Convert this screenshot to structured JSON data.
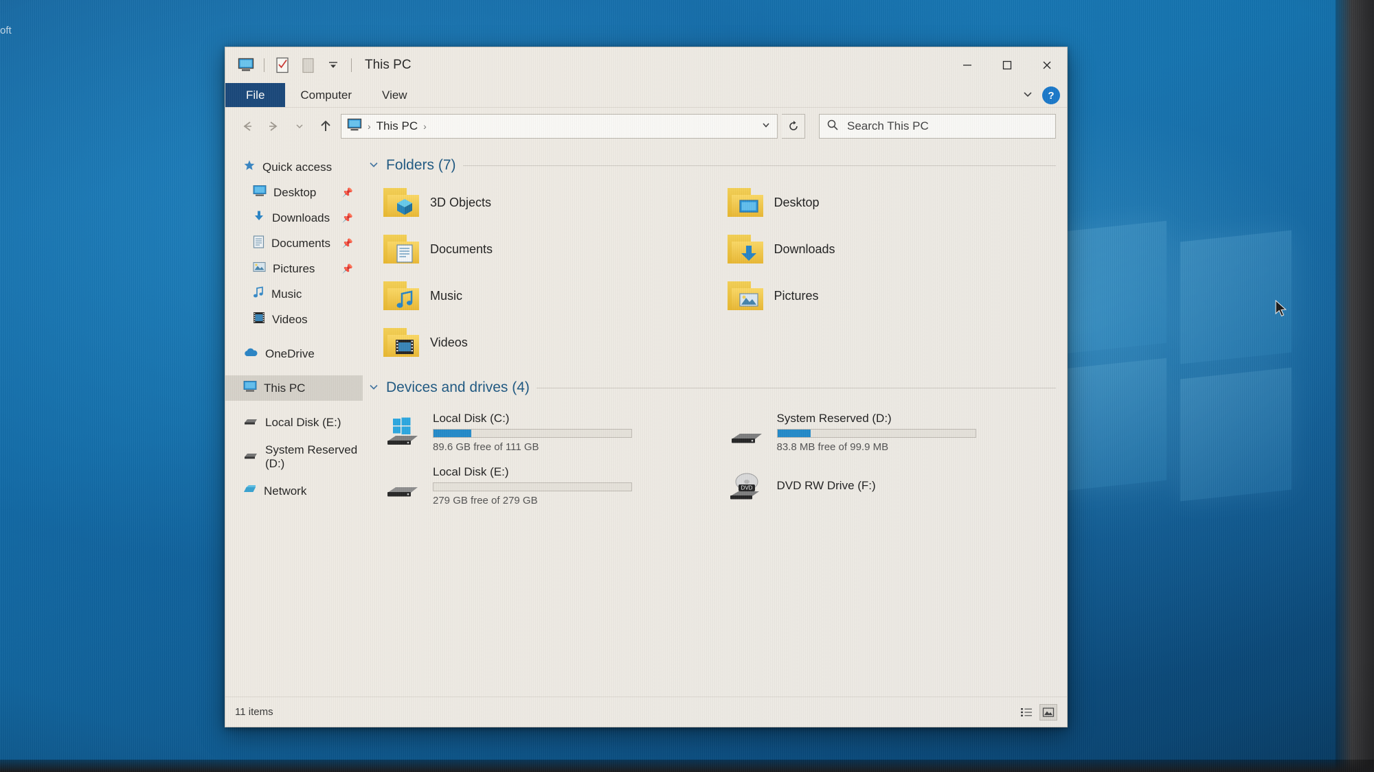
{
  "window": {
    "title": "This PC",
    "quick_access_icons": [
      "this-pc-icon",
      "properties-icon",
      "new-folder-icon",
      "customize-dropdown-icon"
    ],
    "controls": {
      "minimize": "–",
      "maximize": "☐",
      "close": "✕"
    }
  },
  "ribbon": {
    "tabs": [
      {
        "label": "File",
        "active": true
      },
      {
        "label": "Computer",
        "active": false
      },
      {
        "label": "View",
        "active": false
      }
    ],
    "collapse_icon": "chevron-down-icon",
    "help_label": "?"
  },
  "address": {
    "back_icon": "arrow-left-icon",
    "forward_icon": "arrow-right-icon",
    "recent_icon": "chevron-down-icon",
    "up_icon": "arrow-up-icon",
    "location_icon": "this-pc-icon",
    "crumbs": [
      "This PC"
    ],
    "separator": "›",
    "dropdown_icon": "chevron-down-icon",
    "refresh_icon": "refresh-icon"
  },
  "search": {
    "icon": "search-icon",
    "placeholder": "Search This PC",
    "value": ""
  },
  "sidebar": {
    "items": [
      {
        "label": "Quick access",
        "icon": "star-pin-icon",
        "indent": false,
        "pinned": false,
        "selected": false
      },
      {
        "label": "Desktop",
        "icon": "desktop-icon",
        "indent": true,
        "pinned": true,
        "selected": false
      },
      {
        "label": "Downloads",
        "icon": "download-icon",
        "indent": true,
        "pinned": true,
        "selected": false
      },
      {
        "label": "Documents",
        "icon": "document-icon",
        "indent": true,
        "pinned": true,
        "selected": false
      },
      {
        "label": "Pictures",
        "icon": "pictures-icon",
        "indent": true,
        "pinned": true,
        "selected": false
      },
      {
        "label": "Music",
        "icon": "music-icon",
        "indent": true,
        "pinned": false,
        "selected": false
      },
      {
        "label": "Videos",
        "icon": "videos-icon",
        "indent": true,
        "pinned": false,
        "selected": false
      },
      {
        "label": "OneDrive",
        "icon": "cloud-icon",
        "indent": false,
        "pinned": false,
        "selected": false,
        "gap_before": true
      },
      {
        "label": "This PC",
        "icon": "this-pc-icon",
        "indent": false,
        "pinned": false,
        "selected": true,
        "gap_before": true
      },
      {
        "label": "Local Disk (E:)",
        "icon": "drive-icon",
        "indent": false,
        "pinned": false,
        "selected": false,
        "gap_before": true
      },
      {
        "label": "System Reserved (D:)",
        "icon": "drive-icon",
        "indent": false,
        "pinned": false,
        "selected": false,
        "gap_before": true
      },
      {
        "label": "Network",
        "icon": "network-icon",
        "indent": false,
        "pinned": false,
        "selected": false,
        "gap_before": true
      }
    ]
  },
  "main": {
    "folders_group": {
      "title": "Folders (7)",
      "chevron": "chevron-down-icon",
      "items": [
        {
          "label": "3D Objects",
          "icon": "folder-3d-objects-icon"
        },
        {
          "label": "Desktop",
          "icon": "folder-desktop-icon"
        },
        {
          "label": "Documents",
          "icon": "folder-documents-icon"
        },
        {
          "label": "Downloads",
          "icon": "folder-downloads-icon"
        },
        {
          "label": "Music",
          "icon": "folder-music-icon"
        },
        {
          "label": "Pictures",
          "icon": "folder-pictures-icon"
        },
        {
          "label": "Videos",
          "icon": "folder-videos-icon"
        }
      ]
    },
    "drives_group": {
      "title": "Devices and drives (4)",
      "chevron": "chevron-down-icon",
      "items": [
        {
          "name": "Local Disk (C:)",
          "free": "89.6 GB free of 111 GB",
          "used_percent": 19,
          "icon": "windows-drive-icon",
          "has_bar": true
        },
        {
          "name": "System Reserved (D:)",
          "free": "83.8 MB free of 99.9 MB",
          "used_percent": 17,
          "icon": "drive-icon",
          "has_bar": true
        },
        {
          "name": "Local Disk (E:)",
          "free": "279 GB free of 279 GB",
          "used_percent": 0,
          "icon": "drive-icon",
          "has_bar": true
        },
        {
          "name": "DVD RW Drive (F:)",
          "free": "",
          "used_percent": 0,
          "icon": "dvd-drive-icon",
          "has_bar": false,
          "badge": "DVD"
        }
      ]
    }
  },
  "statusbar": {
    "items_count": "11 items",
    "view_details_icon": "details-view-icon",
    "view_large_icons_icon": "large-icons-view-icon"
  },
  "desktop": {
    "edge_label": "oft",
    "cursor_icon": "mouse-pointer-icon"
  },
  "colors": {
    "accent_blue": "#1a86c8",
    "file_tab": "#0e3f75",
    "group_header": "#14517d",
    "window_bg": "#efebe4",
    "selection": "#d4d0c8",
    "folder_yellow": "#f5cf4e"
  }
}
